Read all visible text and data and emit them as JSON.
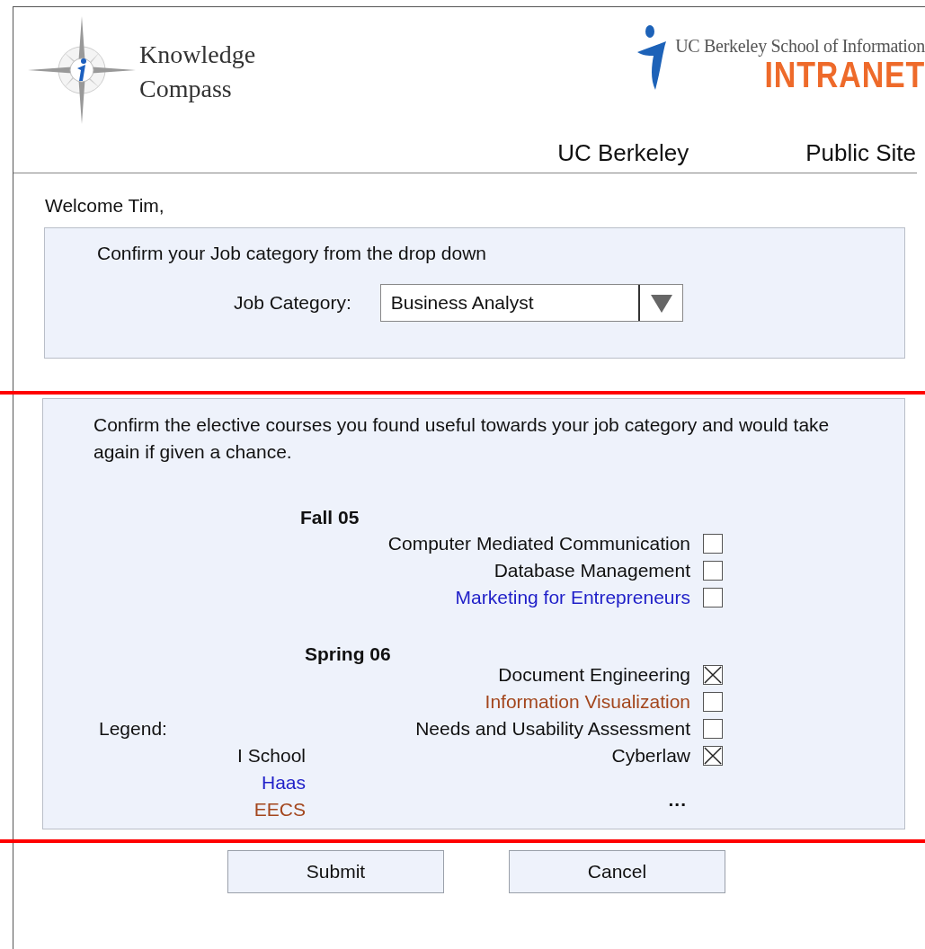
{
  "header": {
    "logo_lines": [
      "Knowledge",
      "Compass"
    ],
    "school_name": "UC Berkeley School of Information",
    "intranet_label": "INTRANET",
    "nav_links": [
      "UC Berkeley",
      "Public Site"
    ]
  },
  "greeting": "Welcome Tim,",
  "job_panel": {
    "instruction": "Confirm your Job category from the drop down",
    "field_label": "Job Category:",
    "value": "Business Analyst"
  },
  "courses_panel": {
    "instruction": "Confirm the elective courses you found useful towards your job category and would take again if given a chance.",
    "terms": [
      {
        "name": "Fall 05",
        "courses": [
          {
            "name": "Computer Mediated Communication",
            "color": "#111111",
            "checked": false
          },
          {
            "name": "Database Management",
            "color": "#111111",
            "checked": false
          },
          {
            "name": "Marketing for Entrepreneurs",
            "color": "#1f1fc8",
            "checked": false
          }
        ]
      },
      {
        "name": "Spring 06",
        "courses": [
          {
            "name": "Document Engineering",
            "color": "#111111",
            "checked": true
          },
          {
            "name": "Information Visualization",
            "color": "#a3461d",
            "checked": false
          },
          {
            "name": "Needs and Usability Assessment",
            "color": "#111111",
            "checked": false
          },
          {
            "name": "Cyberlaw",
            "color": "#111111",
            "checked": true
          }
        ]
      }
    ],
    "more": "...",
    "legend": {
      "title": "Legend:",
      "items": [
        {
          "label": "I School",
          "color": "#111111"
        },
        {
          "label": "Haas",
          "color": "#1f1fc8"
        },
        {
          "label": "EECS",
          "color": "#a3461d"
        }
      ]
    }
  },
  "buttons": [
    "Submit",
    "Cancel"
  ]
}
